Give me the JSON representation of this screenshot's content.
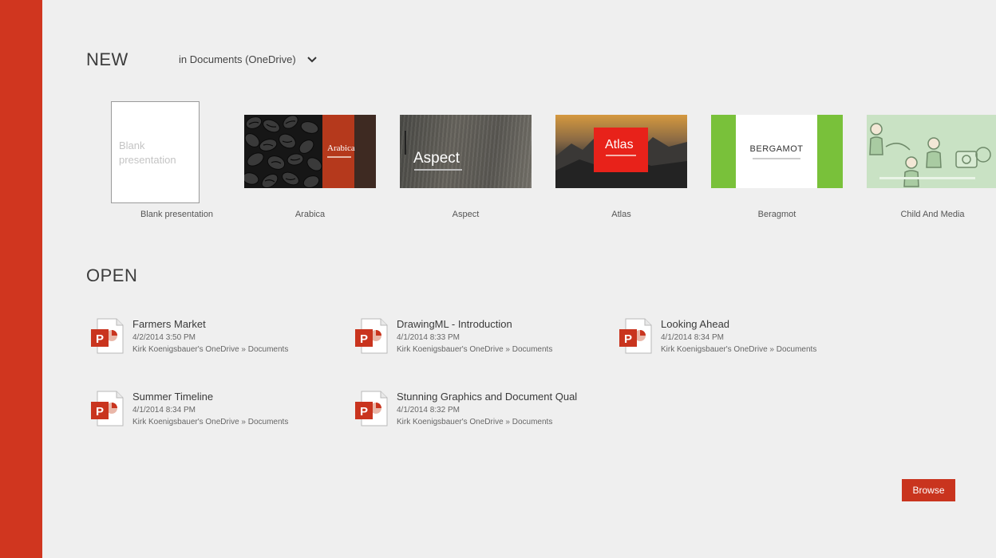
{
  "new_section": {
    "title": "NEW",
    "location": "in Documents (OneDrive)",
    "templates": [
      {
        "name": "Blank presentation",
        "thumb_text": "Blank presentation"
      },
      {
        "name": "Arabica",
        "thumb_text": "Arabica"
      },
      {
        "name": "Aspect",
        "thumb_text": "Aspect"
      },
      {
        "name": "Atlas",
        "thumb_text": "Atlas"
      },
      {
        "name": "Beragmot",
        "thumb_text": "BERGAMOT"
      },
      {
        "name": "Child And Media"
      }
    ]
  },
  "open_section": {
    "title": "OPEN",
    "files": [
      {
        "name": "Farmers Market",
        "date": "4/2/2014 3:50 PM",
        "location": "Kirk Koenigsbauer's OneDrive » Documents"
      },
      {
        "name": "DrawingML - Introduction",
        "date": "4/1/2014 8:33 PM",
        "location": "Kirk Koenigsbauer's OneDrive » Documents"
      },
      {
        "name": "Looking Ahead",
        "date": "4/1/2014 8:34 PM",
        "location": "Kirk Koenigsbauer's OneDrive » Documents"
      },
      {
        "name": "Summer Timeline",
        "date": "4/1/2014 8:34 PM",
        "location": "Kirk Koenigsbauer's OneDrive » Documents"
      },
      {
        "name": "Stunning Graphics and Document Qual",
        "date": "4/1/2014 8:32 PM",
        "location": "Kirk Koenigsbauer's OneDrive » Documents"
      }
    ]
  },
  "browse_label": "Browse",
  "colors": {
    "accent": "#d0361f",
    "background": "#efefef"
  }
}
